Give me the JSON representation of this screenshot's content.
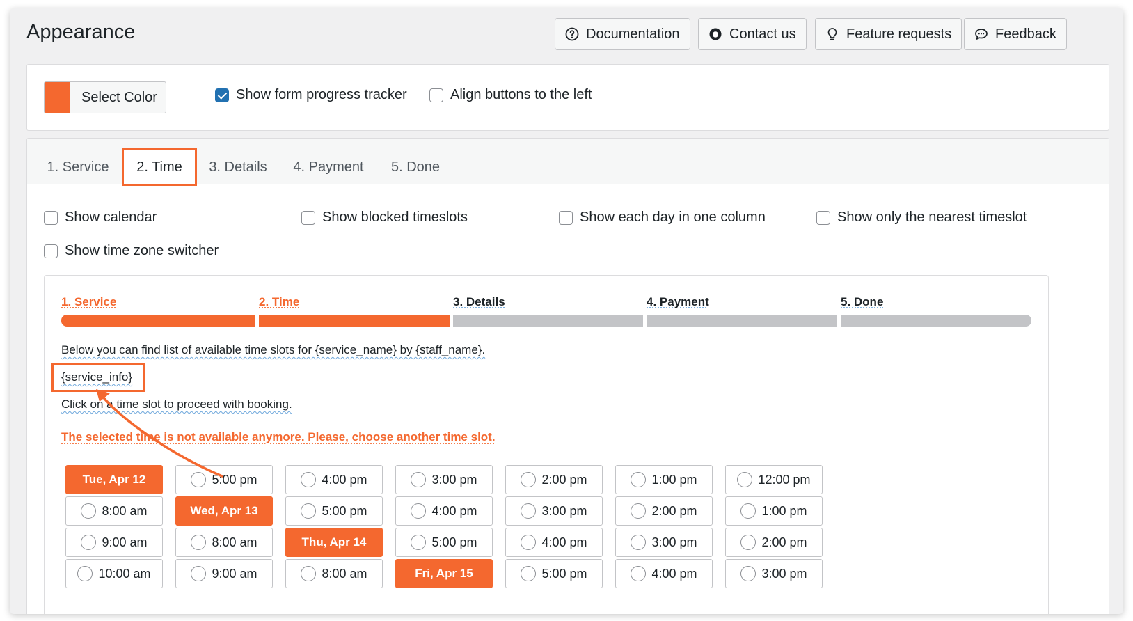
{
  "page": {
    "title": "Appearance"
  },
  "header_buttons": [
    {
      "label": "Documentation",
      "icon": "question-circle-icon"
    },
    {
      "label": "Contact us",
      "icon": "headset-icon"
    },
    {
      "label": "Feature requests",
      "icon": "lightbulb-icon"
    },
    {
      "label": "Feedback",
      "icon": "chat-bubble-icon"
    }
  ],
  "settings": {
    "color_button": "Select Color",
    "accent_color": "#f4682f",
    "show_progress_tracker": {
      "label": "Show form progress tracker",
      "checked": true
    },
    "align_buttons_left": {
      "label": "Align buttons to the left",
      "checked": false
    }
  },
  "tabs": [
    "1. Service",
    "2. Time",
    "3. Details",
    "4. Payment",
    "5. Done"
  ],
  "active_tab": "2. Time",
  "time_options": [
    {
      "label": "Show calendar",
      "checked": false
    },
    {
      "label": "Show blocked timeslots",
      "checked": false
    },
    {
      "label": "Show each day in one column",
      "checked": false
    },
    {
      "label": "Show only the nearest timeslot",
      "checked": false
    },
    {
      "label": "Show time zone switcher",
      "checked": false
    }
  ],
  "preview": {
    "steps": [
      "1. Service",
      "2. Time",
      "3. Details",
      "4. Payment",
      "5. Done"
    ],
    "intro": "Below you can find list of available time slots for {service_name} by {staff_name}.",
    "service_info": "{service_info}",
    "instruction": "Click on a time slot to proceed with booking.",
    "error": "The selected time is not available anymore. Please, choose another time slot.",
    "columns": [
      [
        "Tue, Apr 12",
        "8:00 am",
        "9:00 am",
        "10:00 am"
      ],
      [
        "5:00 pm",
        "Wed, Apr 13",
        "8:00 am",
        "9:00 am"
      ],
      [
        "4:00 pm",
        "5:00 pm",
        "Thu, Apr 14",
        "8:00 am"
      ],
      [
        "3:00 pm",
        "4:00 pm",
        "5:00 pm",
        "Fri, Apr 15"
      ],
      [
        "2:00 pm",
        "3:00 pm",
        "4:00 pm",
        "5:00 pm"
      ],
      [
        "1:00 pm",
        "2:00 pm",
        "3:00 pm",
        "4:00 pm"
      ],
      [
        "12:00 pm",
        "1:00 pm",
        "2:00 pm",
        "3:00 pm"
      ]
    ]
  }
}
